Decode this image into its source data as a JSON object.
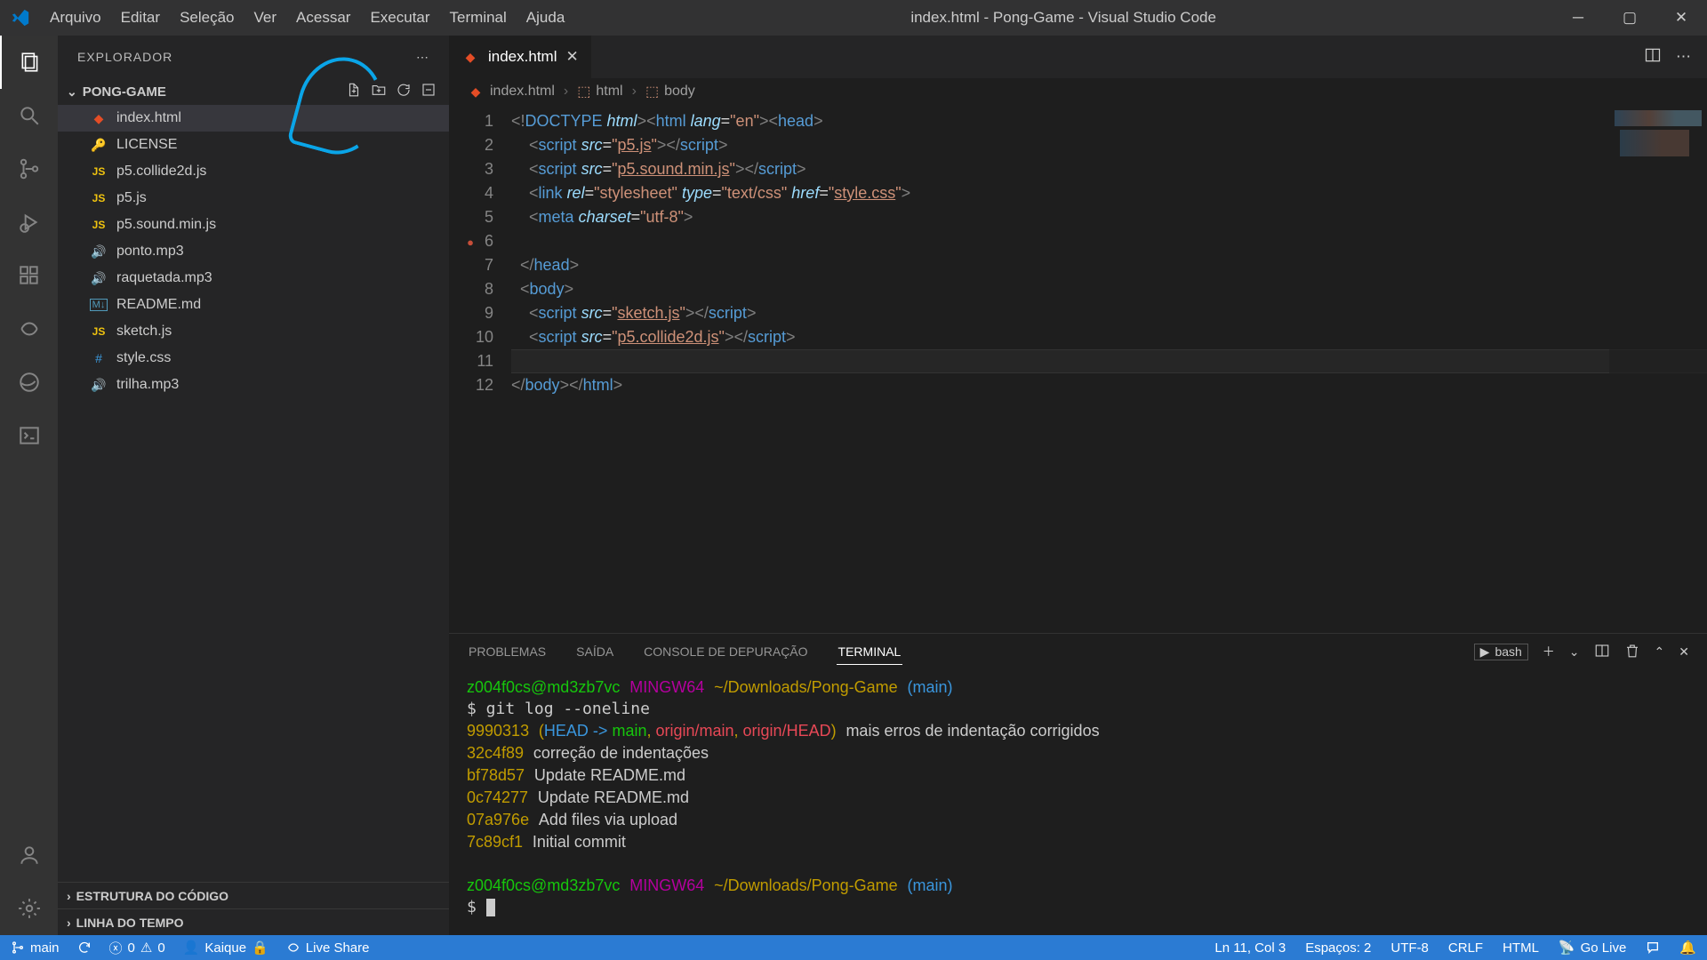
{
  "title": "index.html - Pong-Game - Visual Studio Code",
  "menu": [
    "Arquivo",
    "Editar",
    "Seleção",
    "Ver",
    "Acessar",
    "Executar",
    "Terminal",
    "Ajuda"
  ],
  "explorer": {
    "header": "EXPLORADOR",
    "folder": "PONG-GAME",
    "files": [
      {
        "name": "index.html",
        "icon": "html",
        "sel": true
      },
      {
        "name": "LICENSE",
        "icon": "lic"
      },
      {
        "name": "p5.collide2d.js",
        "icon": "js"
      },
      {
        "name": "p5.js",
        "icon": "js"
      },
      {
        "name": "p5.sound.min.js",
        "icon": "js"
      },
      {
        "name": "ponto.mp3",
        "icon": "audio"
      },
      {
        "name": "raquetada.mp3",
        "icon": "audio"
      },
      {
        "name": "README.md",
        "icon": "md"
      },
      {
        "name": "sketch.js",
        "icon": "js"
      },
      {
        "name": "style.css",
        "icon": "css"
      },
      {
        "name": "trilha.mp3",
        "icon": "audio"
      }
    ],
    "sections": [
      "ESTRUTURA DO CÓDIGO",
      "LINHA DO TEMPO"
    ]
  },
  "tab": {
    "name": "index.html"
  },
  "breadcrumb": [
    "index.html",
    "html",
    "body"
  ],
  "line_numbers": [
    "1",
    "2",
    "3",
    "4",
    "5",
    "6",
    "7",
    "8",
    "9",
    "10",
    "11",
    "12"
  ],
  "panel_tabs": [
    "PROBLEMAS",
    "SAÍDA",
    "CONSOLE DE DEPURAÇÃO",
    "TERMINAL"
  ],
  "shell_name": "bash",
  "terminal": {
    "user": "z004f0cs@md3zb7vc",
    "mingw": "MINGW64",
    "path": "~/Downloads/Pong-Game",
    "branch": "(main)",
    "cmd": "git log --oneline",
    "commits": [
      {
        "h": "9990313",
        "msg": "mais erros de indentação corrigidos",
        "head": true
      },
      {
        "h": "32c4f89",
        "msg": "correção de indentações"
      },
      {
        "h": "bf78d57",
        "msg": "Update README.md"
      },
      {
        "h": "0c74277",
        "msg": "Update README.md"
      },
      {
        "h": "07a976e",
        "msg": "Add files via upload"
      },
      {
        "h": "7c89cf1",
        "msg": "Initial commit"
      }
    ]
  },
  "status": {
    "branch": "main",
    "errors": "0",
    "warnings": "0",
    "user": "Kaique",
    "liveshare": "Live Share",
    "cursor": "Ln 11, Col 3",
    "spaces": "Espaços: 2",
    "encoding": "UTF-8",
    "eol": "CRLF",
    "lang": "HTML",
    "golive": "Go Live"
  }
}
